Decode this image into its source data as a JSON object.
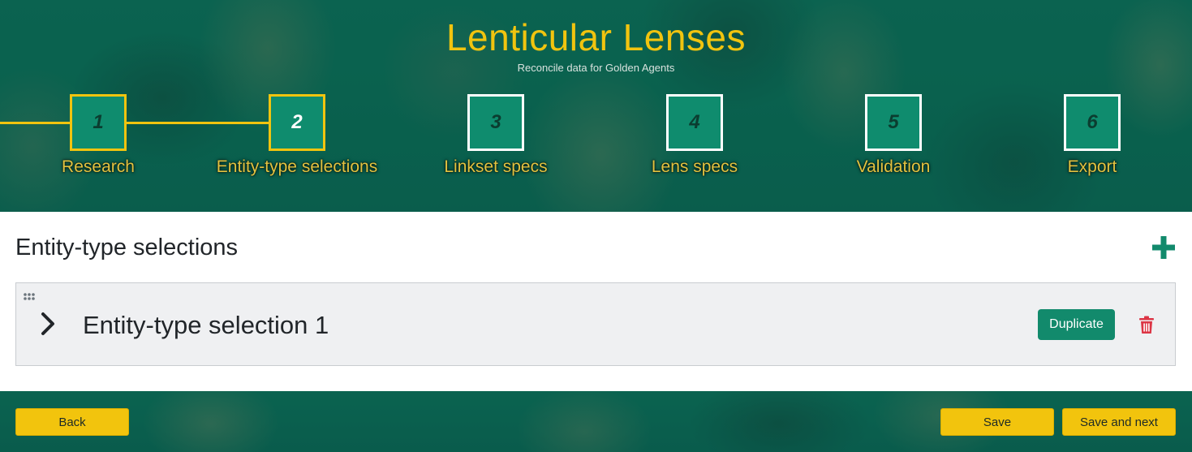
{
  "app": {
    "title": "Lenticular Lenses",
    "subtitle": "Reconcile data for Golden Agents"
  },
  "steps": [
    {
      "number": "1",
      "label": "Research",
      "state": "done"
    },
    {
      "number": "2",
      "label": "Entity-type selections",
      "state": "active"
    },
    {
      "number": "3",
      "label": "Linkset specs",
      "state": "todo"
    },
    {
      "number": "4",
      "label": "Lens specs",
      "state": "todo"
    },
    {
      "number": "5",
      "label": "Validation",
      "state": "todo"
    },
    {
      "number": "6",
      "label": "Export",
      "state": "todo"
    }
  ],
  "section": {
    "title": "Entity-type selections",
    "add_icon": "plus-icon"
  },
  "cards": [
    {
      "title": "Entity-type selection 1",
      "duplicate_label": "Duplicate",
      "delete_icon": "trash-icon",
      "expand_icon": "chevron-right-icon",
      "drag_icon": "drag-handle-icon"
    }
  ],
  "footer": {
    "back_label": "Back",
    "save_label": "Save",
    "save_next_label": "Save and next"
  },
  "colors": {
    "accent_yellow": "#f1c40f",
    "primary_green": "#128a6c",
    "danger_red": "#dc3545"
  }
}
